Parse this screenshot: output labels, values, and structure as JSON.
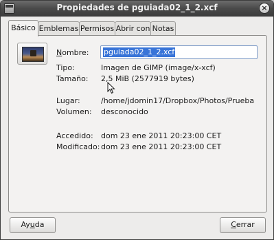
{
  "window": {
    "title": "Propiedades de pguiada02_1_2.xcf",
    "close_glyph": "×"
  },
  "tabs": [
    {
      "label": "Básico",
      "active": true
    },
    {
      "label": "Emblemas",
      "active": false
    },
    {
      "label": "Permisos",
      "active": false
    },
    {
      "label": "Abrir con",
      "active": false
    },
    {
      "label": "Notas",
      "active": false
    }
  ],
  "basic": {
    "thumbnail_icon": "image-thumbnail-icon",
    "name": {
      "label_mnemonic": "N",
      "label_rest": "ombre:",
      "value": "pguiada02_1_2.xcf"
    },
    "type": {
      "label": "Tipo:",
      "value": "Imagen de GIMP (image/x-xcf)"
    },
    "size": {
      "label": "Tamaño:",
      "value": "2,5 MiB (2577919 bytes)"
    },
    "location": {
      "label": "Lugar:",
      "value": "/home/jdomin17/Dropbox/Photos/Prueba"
    },
    "volume": {
      "label": "Volumen:",
      "value": "desconocido"
    },
    "accessed": {
      "label": "Accedido:",
      "value": "dom 23 ene 2011 20:23:00 CET"
    },
    "modified": {
      "label": "Modificado:",
      "value": "dom 23 ene 2011 20:23:00 CET"
    }
  },
  "buttons": {
    "help": {
      "pre": "Ay",
      "mnemonic": "u",
      "post": "da"
    },
    "close": {
      "pre": "",
      "mnemonic": "C",
      "post": "errar"
    }
  },
  "colors": {
    "selection": "#3874d8",
    "titlebar": "#4a4a4a",
    "background": "#edeceb"
  }
}
